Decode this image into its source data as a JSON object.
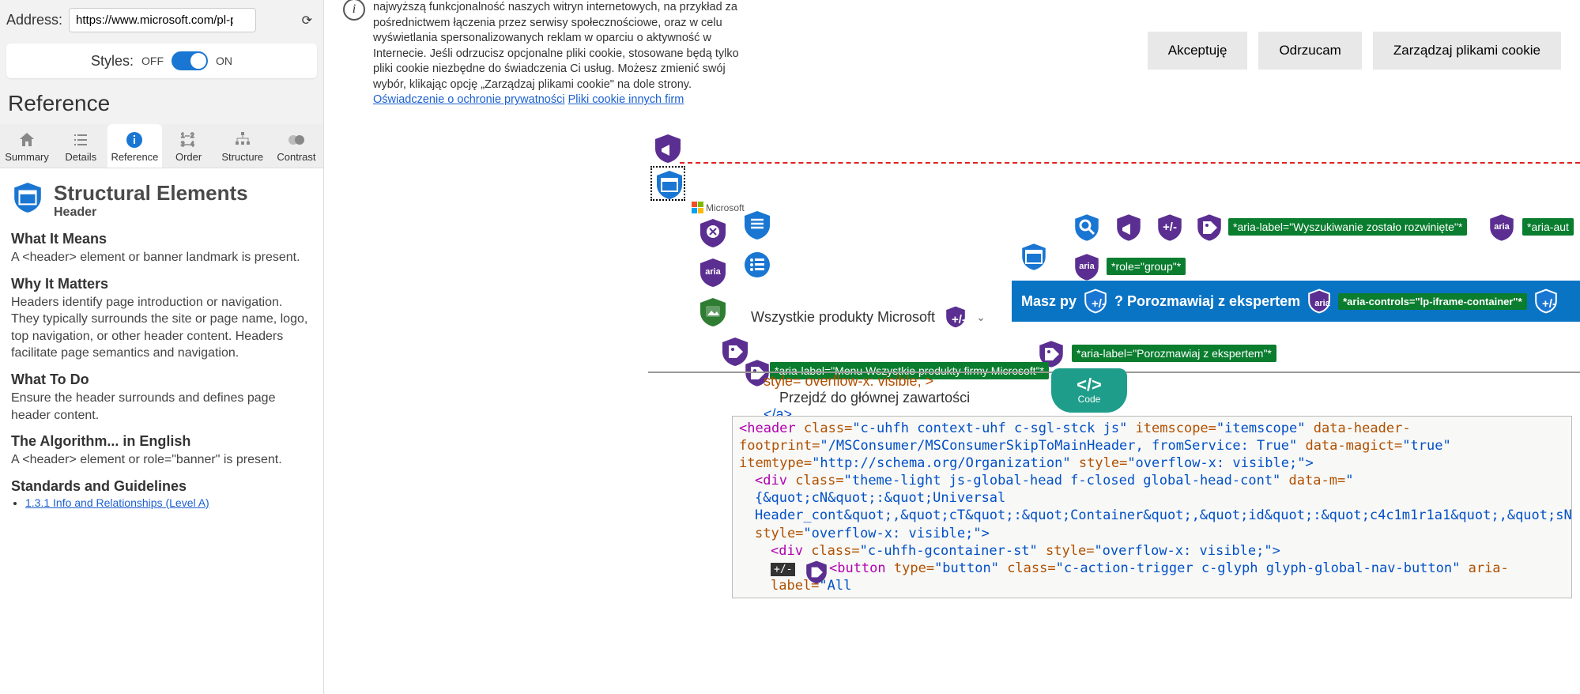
{
  "sidebar": {
    "addressLabel": "Address:",
    "addressValue": "https://www.microsoft.com/pl-pl/store/collec",
    "stylesLabel": "Styles:",
    "off": "OFF",
    "on": "ON",
    "refTitle": "Reference",
    "tabs": {
      "summary": "Summary",
      "details": "Details",
      "reference": "Reference",
      "order": "Order",
      "structure": "Structure",
      "contrast": "Contrast"
    },
    "panel": {
      "title": "Structural Elements",
      "subtitle": "Header",
      "whatItMeansH": "What It Means",
      "whatItMeans": "A <header> element or banner landmark is present.",
      "whyH": "Why It Matters",
      "why": "Headers identify page introduction or navigation. They typically surrounds the site or page name, logo, top navigation, or other header content. Headers facilitate page semantics and navigation.",
      "whatToDoH": "What To Do",
      "whatToDo": "Ensure the header surrounds and defines page header content.",
      "algoH": "The Algorithm... in English",
      "algo": "A <header> element or role=\"banner\" is present.",
      "standardsH": "Standards and Guidelines",
      "standardsLink": "1.3.1 Info and Relationships (Level A)"
    }
  },
  "cookie": {
    "text": "najwyższą funkcjonalność naszych witryn internetowych, na przykład za pośrednictwem łączenia przez serwisy społecznościowe, oraz w celu wyświetlania spersonalizowanych reklam w oparciu o aktywność w Internecie. Jeśli odrzucisz opcjonalne pliki cookie, stosowane będą tylko pliki cookie niezbędne do świadczenia Ci usług. Możesz zmienić swój wybór, klikając opcję „Zarządzaj plikami cookie\" na dole strony. ",
    "privLink": "Oświadczenie o ochronie prywatności",
    "thirdLink": "Pliki cookie innych firm",
    "accept": "Akceptuję",
    "reject": "Odrzucam",
    "manage": "Zarządzaj plikami cookie"
  },
  "overlay": {
    "msLogo": "Microsoft",
    "ariaSearchExpanded": "*aria-label=\"Wyszukiwanie zostało rozwinięte\"*",
    "ariaAuto": "*aria-aut",
    "roleGroup": "*role=\"group\"*",
    "blueBarPre": "Masz py",
    "blueBarPost": "? Porozmawiaj z ekspertem",
    "ariaControls": "*aria-controls=\"lp-iframe-container\"*",
    "ariaExpert": "*aria-label=\"Porozmawiaj z ekspertem\"*",
    "ariaMenu": "*aria-label=\"Menu Wszystkie produkty firmy Microsoft\"*",
    "allProducts": "Wszystkie produkty Microsoft",
    "styleOverflow": "style= overflow-x: visible; >",
    "skipMain": "Przejdź do głównej zawartości",
    "closeA": "</a>",
    "codeLabel": "Code"
  },
  "code": {
    "l1a": "<header ",
    "l1b": "class=",
    "l1c": "\"c-uhfh context-uhf c-sgl-stck js\" ",
    "l1d": "itemscope=",
    "l1e": "\"itemscope\" ",
    "l1f": "data-header-footprint=",
    "l1g": "\"/MSConsumer/MSConsumerSkipToMainHeader, fromService: True\" ",
    "l1h": "data-magict=",
    "l1i": "\"true\"",
    "l2a": "itemtype=",
    "l2b": "\"http://schema.org/Organization\" ",
    "l2c": "style=",
    "l2d": "\"overflow-x: visible;\">",
    "l3a": "<div ",
    "l3b": "class=",
    "l3c": "\"theme-light js-global-head f-closed global-head-cont\" ",
    "l3d": "data-m=",
    "l3e": "\"{&quot;cN&quot;:&quot;Universal Header_cont&quot;,&quot;cT&quot;:&quot;Container&quot;,&quot;id&quot;:&quot;c4c1m1r1a1&quot;,&quot;sN&quo",
    "l4a": "style=",
    "l4b": "\"overflow-x: visible;\">",
    "l5a": "<div ",
    "l5b": "class=",
    "l5c": "\"c-uhfh-gcontainer-st\" ",
    "l5d": "style=",
    "l5e": "\"overflow-x: visible;\">",
    "l6a": "<button ",
    "l6b": "type=",
    "l6c": "\"button\" ",
    "l6d": "class=",
    "l6e": "\"c-action-trigger c-glyph glyph-global-nav-button\" ",
    "l6f": "aria-label=",
    "l6g": "\"All"
  }
}
